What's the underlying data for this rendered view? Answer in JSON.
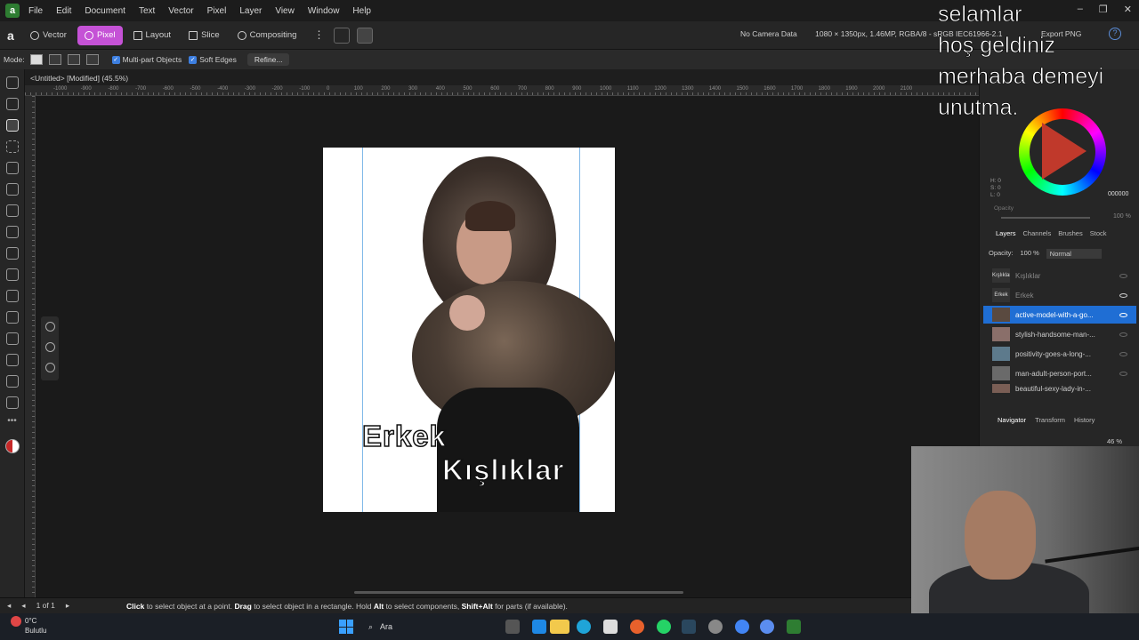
{
  "menubar": {
    "items": [
      "File",
      "Edit",
      "Document",
      "Text",
      "Vector",
      "Pixel",
      "Layer",
      "View",
      "Window",
      "Help"
    ]
  },
  "toolbar": {
    "personas": [
      "Vector",
      "Pixel",
      "Layout",
      "Slice",
      "Compositing"
    ],
    "active_persona": "Pixel",
    "camera": "No Camera Data",
    "doc_info": "1080 × 1350px, 1.46MP, RGBA/8 - sRGB IEC61966-2.1",
    "export": "Export PNG"
  },
  "contextbar": {
    "mode_label": "Mode:",
    "multipart": "Multi-part Objects",
    "soft_edges": "Soft Edges",
    "refine": "Refine..."
  },
  "document": {
    "tab": "<Untitled> [Modified] (45.5%)"
  },
  "ruler": {
    "labels": [
      "-1000",
      "-900",
      "-800",
      "-700",
      "-600",
      "-500",
      "-400",
      "-300",
      "-200",
      "-100",
      "0",
      "100",
      "200",
      "300",
      "400",
      "500",
      "600",
      "700",
      "800",
      "900",
      "1000",
      "1100",
      "1200",
      "1300",
      "1400",
      "1500",
      "1600",
      "1700",
      "1800",
      "1900",
      "2000",
      "2100"
    ]
  },
  "canvas": {
    "text1": "Erkek",
    "text2": "Kışlıklar"
  },
  "status": {
    "page": "1 of 1",
    "hint_click": "Click",
    "hint_1": " to select object at a point. ",
    "hint_drag": "Drag",
    "hint_2": " to select object in a rectangle. Hold ",
    "hint_alt": "Alt",
    "hint_3": " to select components, ",
    "hint_shiftalt": "Shift+Alt",
    "hint_4": " for parts (if available)."
  },
  "color_panel": {
    "h": "H: 0",
    "s": "S: 0",
    "l": "L: 0",
    "hex": "000000",
    "opacity_label": "Opacity",
    "opacity_value": "100 %"
  },
  "layers_panel": {
    "tabs": [
      "Layers",
      "Channels",
      "Brushes",
      "Stock"
    ],
    "opacity": "Opacity:",
    "opacity_value": "100 %",
    "blend": "Normal",
    "layers": [
      {
        "thumb": "Kışlıklar",
        "name": "Kışlıklar"
      },
      {
        "thumb": "Erkek",
        "name": "Erkek"
      },
      {
        "thumb": "",
        "name": "active-model-with-a-go..."
      },
      {
        "thumb": "",
        "name": "stylish-handsome-man-..."
      },
      {
        "thumb": "",
        "name": "positivity-goes-a-long-..."
      },
      {
        "thumb": "",
        "name": "man-adult-person-port..."
      },
      {
        "thumb": "",
        "name": "beautiful-sexy-lady-in-..."
      }
    ]
  },
  "navigator": {
    "tabs": [
      "Navigator",
      "Transform",
      "History"
    ],
    "zoom": "46 %"
  },
  "taskbar": {
    "temp": "0°C",
    "weather": "Bulutlu",
    "search": "Ara"
  },
  "overlay": {
    "lines": [
      "selamlar",
      "hoş geldiniz",
      "merhaba demeyi",
      "unutma."
    ]
  },
  "colors": {
    "accent_persona": "#c552d6",
    "selection": "#1f6ed4"
  }
}
